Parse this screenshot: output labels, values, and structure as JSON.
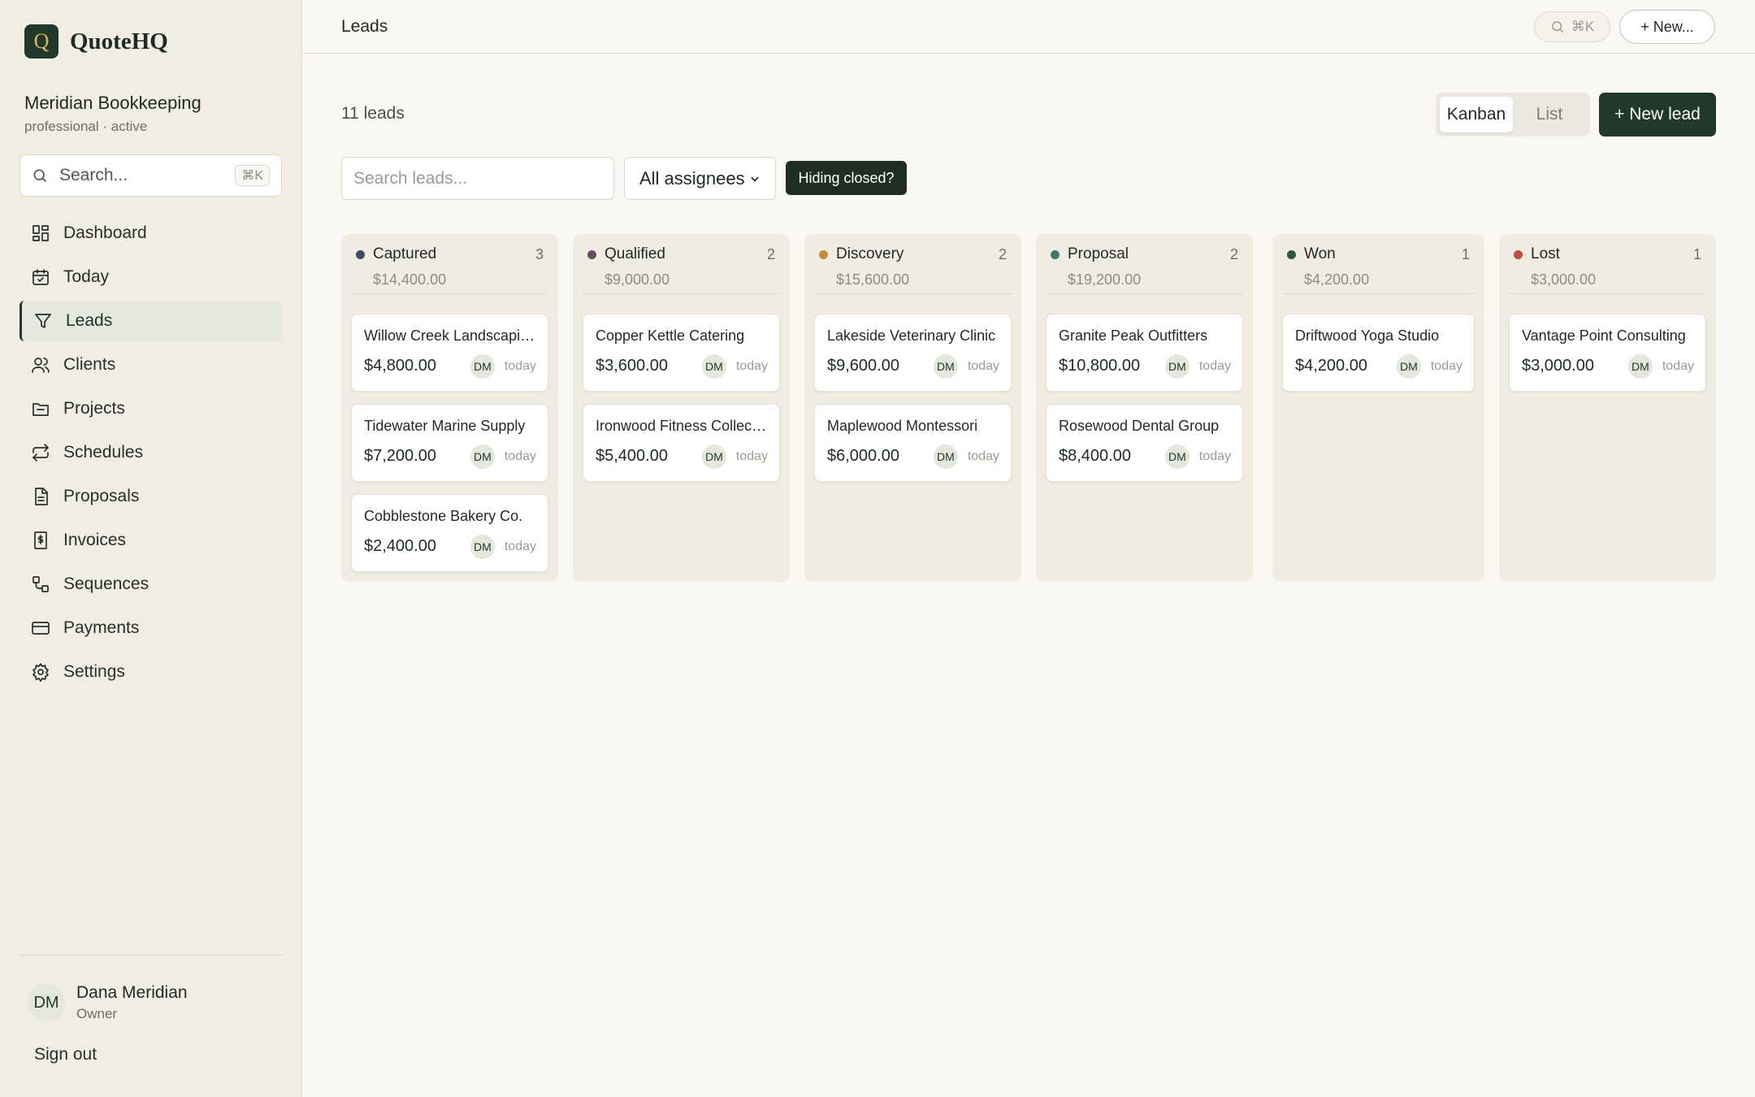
{
  "brand": {
    "logo_letter": "Q",
    "name": "QuoteHQ"
  },
  "org": {
    "name": "Meridian Bookkeeping",
    "sub": "professional · active"
  },
  "sidebar": {
    "search_placeholder": "Search...",
    "search_shortcut": "⌘K",
    "items": [
      {
        "label": "Dashboard",
        "icon": "dashboard-icon"
      },
      {
        "label": "Today",
        "icon": "calendar-icon"
      },
      {
        "label": "Leads",
        "icon": "filter-icon",
        "active": true
      },
      {
        "label": "Clients",
        "icon": "users-icon"
      },
      {
        "label": "Projects",
        "icon": "folder-icon"
      },
      {
        "label": "Schedules",
        "icon": "repeat-icon"
      },
      {
        "label": "Proposals",
        "icon": "document-icon"
      },
      {
        "label": "Invoices",
        "icon": "invoice-icon"
      },
      {
        "label": "Sequences",
        "icon": "workflow-icon"
      },
      {
        "label": "Payments",
        "icon": "credit-card-icon"
      },
      {
        "label": "Settings",
        "icon": "gear-icon"
      }
    ]
  },
  "user": {
    "initials": "DM",
    "name": "Dana Meridian",
    "role": "Owner",
    "signout": "Sign out"
  },
  "topbar": {
    "title": "Leads",
    "search_shortcut": "⌘K",
    "new_label": "+ New..."
  },
  "main": {
    "count": "11 leads",
    "view_kanban": "Kanban",
    "view_list": "List",
    "new_lead": "+ New lead",
    "search_placeholder": "Search leads...",
    "assignee_filter": "All assignees",
    "hiding_closed": "Hiding closed?"
  },
  "colors": {
    "brand": "#20392c",
    "captured": "#3e4a63",
    "qualified": "#6b4a63",
    "discovery": "#c7883a",
    "proposal": "#3e7a6e",
    "won": "#2a5a3a",
    "lost": "#c24a3a"
  },
  "columns": [
    {
      "name": "Captured",
      "count": "3",
      "total": "$14,400.00",
      "color": "#3e4a63",
      "cards": [
        {
          "name": "Willow Creek Landscaping",
          "amount": "$4,800.00",
          "assignee": "DM",
          "date": "today"
        },
        {
          "name": "Tidewater Marine Supply",
          "amount": "$7,200.00",
          "assignee": "DM",
          "date": "today"
        },
        {
          "name": "Cobblestone Bakery Co.",
          "amount": "$2,400.00",
          "assignee": "DM",
          "date": "today"
        }
      ]
    },
    {
      "name": "Qualified",
      "count": "2",
      "total": "$9,000.00",
      "color": "#6b4a63",
      "cards": [
        {
          "name": "Copper Kettle Catering",
          "amount": "$3,600.00",
          "assignee": "DM",
          "date": "today"
        },
        {
          "name": "Ironwood Fitness Collective",
          "amount": "$5,400.00",
          "assignee": "DM",
          "date": "today"
        }
      ]
    },
    {
      "name": "Discovery",
      "count": "2",
      "total": "$15,600.00",
      "color": "#c7883a",
      "cards": [
        {
          "name": "Lakeside Veterinary Clinic",
          "amount": "$9,600.00",
          "assignee": "DM",
          "date": "today"
        },
        {
          "name": "Maplewood Montessori",
          "amount": "$6,000.00",
          "assignee": "DM",
          "date": "today"
        }
      ]
    },
    {
      "name": "Proposal",
      "count": "2",
      "total": "$19,200.00",
      "color": "#3e7a6e",
      "cards": [
        {
          "name": "Granite Peak Outfitters",
          "amount": "$10,800.00",
          "assignee": "DM",
          "date": "today"
        },
        {
          "name": "Rosewood Dental Group",
          "amount": "$8,400.00",
          "assignee": "DM",
          "date": "today"
        }
      ]
    },
    {
      "name": "Won",
      "count": "1",
      "total": "$4,200.00",
      "color": "#2a5a3a",
      "cards": [
        {
          "name": "Driftwood Yoga Studio",
          "amount": "$4,200.00",
          "assignee": "DM",
          "date": "today"
        }
      ]
    },
    {
      "name": "Lost",
      "count": "1",
      "total": "$3,000.00",
      "color": "#c24a3a",
      "cards": [
        {
          "name": "Vantage Point Consulting",
          "amount": "$3,000.00",
          "assignee": "DM",
          "date": "today"
        }
      ]
    }
  ]
}
